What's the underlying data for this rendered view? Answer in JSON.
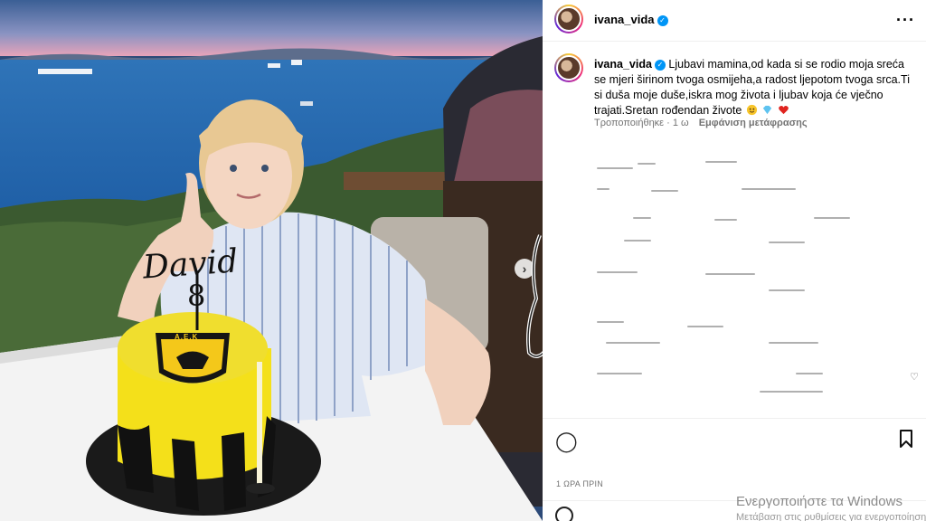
{
  "post": {
    "username": "ivana_vida",
    "caption_text": "Ljubavi mamina,od kada si se rodio moja sreća se mjeri širinom tvoga osmijeha,a radost ljepotom tvoga srca.Ti si duša moje duše,iskra mog života i ljubav koja će vječno trajati.Sretan rođendan živote",
    "edited_label": "Τροποποιήθηκε · 1 ω",
    "translate_label": "Εμφάνιση μετάφρασης",
    "timestamp": "1 ΩΡΑ ΠΡΙΝ"
  },
  "photo": {
    "cake_topper_text": "David",
    "cake_topper_number": "8",
    "cake_badge_text": "Α.Ε.Κ"
  },
  "colors": {
    "verified": "#0095f6",
    "cake_yellow": "#f4e01a",
    "sea": "#1f5fa6"
  },
  "icons": {
    "more": "more-horizontal-icon",
    "next": "chevron-right-icon",
    "bookmark": "bookmark-icon",
    "comment": "comment-icon",
    "heart": "heart-icon",
    "emoji": "emoji-icon"
  },
  "watermark": {
    "line1": "Ενεργοποιήστε τα Windows",
    "line2": "Μετάβαση στις ρυθμίσεις για ενεργοποίηση"
  }
}
